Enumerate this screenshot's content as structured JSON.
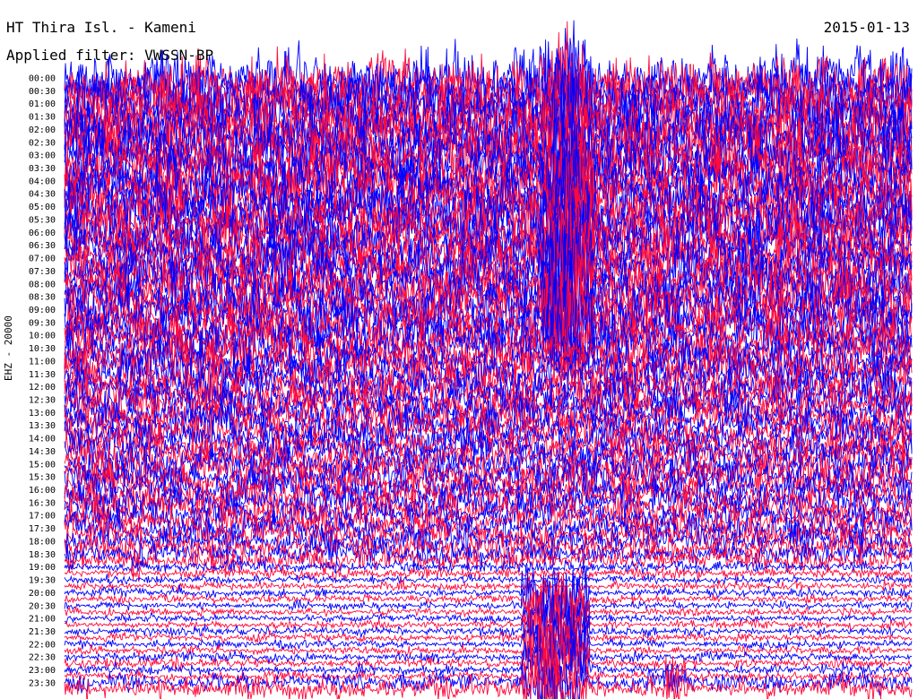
{
  "header": {
    "station": "HT Thira Isl. - Kameni",
    "date": "2015-01-13",
    "filter": "Applied filter: VWSSN-BP"
  },
  "channel_label": "EHZ - 20000",
  "colors": {
    "trace_a": "#0000ff",
    "trace_b": "#ff0a3c",
    "background": "#ffffff"
  },
  "chart_data": {
    "type": "line",
    "subtype": "helicorder (seismogram drum plot)",
    "title": "HT Thira Isl. - Kameni",
    "date": "2015-01-13",
    "ylabel": "EHZ - 20000",
    "row_interval_minutes": 15,
    "tick_labels": [
      "00:00",
      "00:30",
      "01:00",
      "01:30",
      "02:00",
      "02:30",
      "03:00",
      "03:30",
      "04:00",
      "04:30",
      "05:00",
      "05:30",
      "06:00",
      "06:30",
      "07:00",
      "07:30",
      "08:00",
      "08:30",
      "09:00",
      "09:30",
      "10:00",
      "10:30",
      "11:00",
      "11:30",
      "12:00",
      "12:30",
      "13:00",
      "13:30",
      "14:00",
      "14:30",
      "15:00",
      "15:30",
      "16:00",
      "16:30",
      "17:00",
      "17:30",
      "18:00",
      "18:30",
      "19:00",
      "19:30",
      "20:00",
      "20:30",
      "21:00",
      "21:30",
      "22:00",
      "22:30",
      "23:00",
      "23:30"
    ],
    "series": [
      {
        "color": "#0000ff",
        "rows": "even"
      },
      {
        "color": "#ff0a3c",
        "rows": "odd"
      }
    ],
    "row_amplitude_relative": [
      3.2,
      3.2,
      3.2,
      3.2,
      3.1,
      3.1,
      3.1,
      3.1,
      3.1,
      3.1,
      3.0,
      3.0,
      3.0,
      3.0,
      3.0,
      3.0,
      2.9,
      2.9,
      2.9,
      2.9,
      2.8,
      2.8,
      2.8,
      2.8,
      2.8,
      2.8,
      2.7,
      2.7,
      2.7,
      2.7,
      2.7,
      2.7,
      2.6,
      2.6,
      2.6,
      2.6,
      2.5,
      2.5,
      2.5,
      2.5,
      2.4,
      2.4,
      2.3,
      2.3,
      2.2,
      2.2,
      2.1,
      2.1,
      2.0,
      2.0,
      2.0,
      2.0,
      1.9,
      1.9,
      1.9,
      1.9,
      1.8,
      1.8,
      1.8,
      1.8,
      1.8,
      1.8,
      1.8,
      1.8,
      1.7,
      1.7,
      1.7,
      1.7,
      1.6,
      1.6,
      1.5,
      1.5,
      1.4,
      1.4,
      1.3,
      1.2,
      0.7,
      0.6,
      0.45,
      0.45,
      0.45,
      0.45,
      0.4,
      0.4,
      0.4,
      0.4,
      0.45,
      0.45,
      0.45,
      0.45,
      0.5,
      0.5,
      0.55,
      0.55,
      1.0,
      1.1
    ],
    "events": [
      {
        "start_time": "00:00",
        "end_time": "10:00",
        "minute_in_row": 8.9,
        "duration_minutes": 0.45,
        "relative_amplitude": 8
      },
      {
        "start_time": "20:00",
        "end_time": "23:45",
        "minute_in_row": 8.7,
        "duration_minutes": 0.6,
        "relative_amplitude": 5
      },
      {
        "start_time": "23:15",
        "end_time": "23:45",
        "minute_in_row": 10.8,
        "duration_minutes": 0.2,
        "relative_amplitude": 3
      }
    ]
  }
}
